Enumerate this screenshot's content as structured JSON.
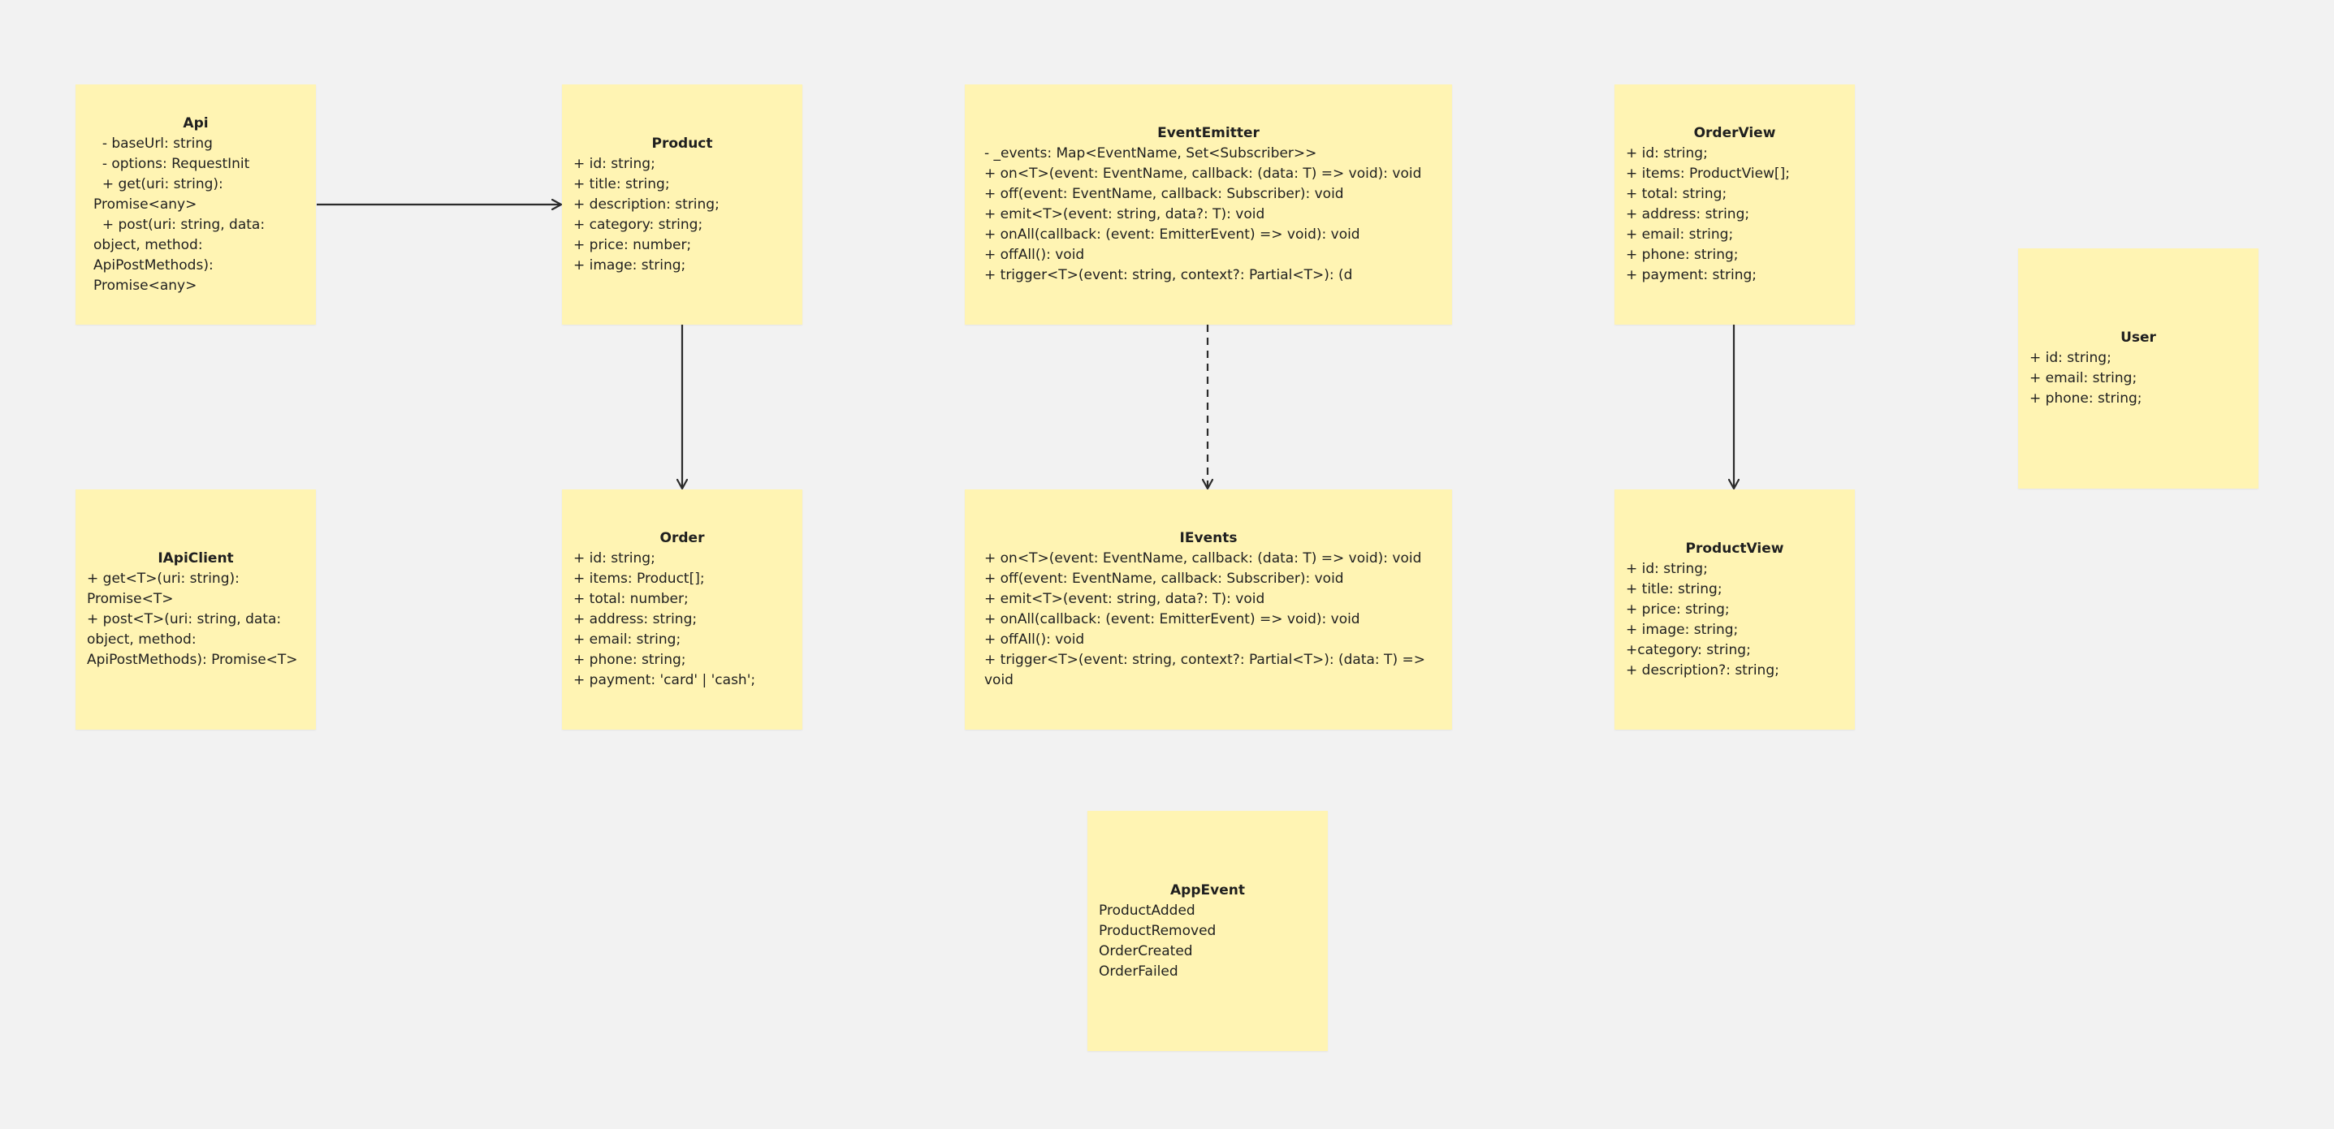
{
  "colors": {
    "canvas": "#f2f2f2",
    "sticky_note": "#fff4b3",
    "connector": "#2b2b2b"
  },
  "notes": {
    "api": {
      "title": "Api",
      "lines": [
        "  - baseUrl: string",
        "  - options: RequestInit",
        "  + get(uri: string): Promise<any>",
        "  + post(uri: string, data: object, method: ApiPostMethods): Promise<any>"
      ]
    },
    "product": {
      "title": "Product",
      "lines": [
        "+ id: string;",
        "+ title: string;",
        "+ description: string;",
        "+ category: string;",
        "+ price: number;",
        "+ image: string;"
      ]
    },
    "event_emitter": {
      "title": "EventEmitter",
      "lines": [
        "- _events: Map<EventName, Set<Subscriber>>",
        "+ on<T>(event: EventName, callback: (data: T) => void): void",
        "+ off(event: EventName, callback: Subscriber): void",
        "+ emit<T>(event: string, data?: T): void",
        "+ onAll(callback: (event: EmitterEvent) => void): void",
        "+ offAll(): void",
        "+ trigger<T>(event: string, context?: Partial<T>): (d"
      ]
    },
    "order_view": {
      "title": "OrderView",
      "lines": [
        "+ id: string;",
        "+ items: ProductView[];",
        "+ total: string;",
        "+ address: string;",
        "+ email: string;",
        "+ phone: string;",
        "+ payment: string;"
      ]
    },
    "user": {
      "title": "User",
      "lines": [
        "+ id: string;",
        "+ email: string;",
        "+ phone: string;"
      ]
    },
    "iapiclient": {
      "title": "IApiClient",
      "lines": [
        "+ get<T>(uri: string): Promise<T>",
        "+ post<T>(uri: string, data: object, method: ApiPostMethods): Promise<T>"
      ]
    },
    "order": {
      "title": "Order",
      "lines": [
        "+ id: string;",
        "+ items: Product[];",
        "+ total: number;",
        "+ address: string;",
        "+ email: string;",
        "+ phone: string;",
        "+ payment: 'card' | 'cash';"
      ]
    },
    "ievents": {
      "title": "IEvents",
      "lines": [
        "+ on<T>(event: EventName, callback: (data: T) => void): void",
        "+ off(event: EventName, callback: Subscriber): void",
        "+ emit<T>(event: string, data?: T): void",
        "+ onAll(callback: (event: EmitterEvent) => void): void",
        "+ offAll(): void",
        "+ trigger<T>(event: string, context?: Partial<T>): (data: T) => void"
      ]
    },
    "product_view": {
      "title": "ProductView",
      "lines": [
        "+ id: string;",
        "+ title: string;",
        "+ price: string;",
        "+ image: string;",
        "+category: string;",
        "+ description?: string;"
      ]
    },
    "app_event": {
      "title": "AppEvent",
      "lines": [
        "ProductAdded",
        "ProductRemoved",
        "OrderCreated",
        "OrderFailed"
      ]
    }
  },
  "connectors": [
    {
      "from": "api",
      "to": "product",
      "style": "solid",
      "head": "arrow"
    },
    {
      "from": "product",
      "to": "order",
      "style": "solid",
      "head": "arrow"
    },
    {
      "from": "event_emitter",
      "to": "ievents",
      "style": "dashed",
      "head": "arrow"
    },
    {
      "from": "order_view",
      "to": "product_view",
      "style": "solid",
      "head": "arrow"
    }
  ]
}
